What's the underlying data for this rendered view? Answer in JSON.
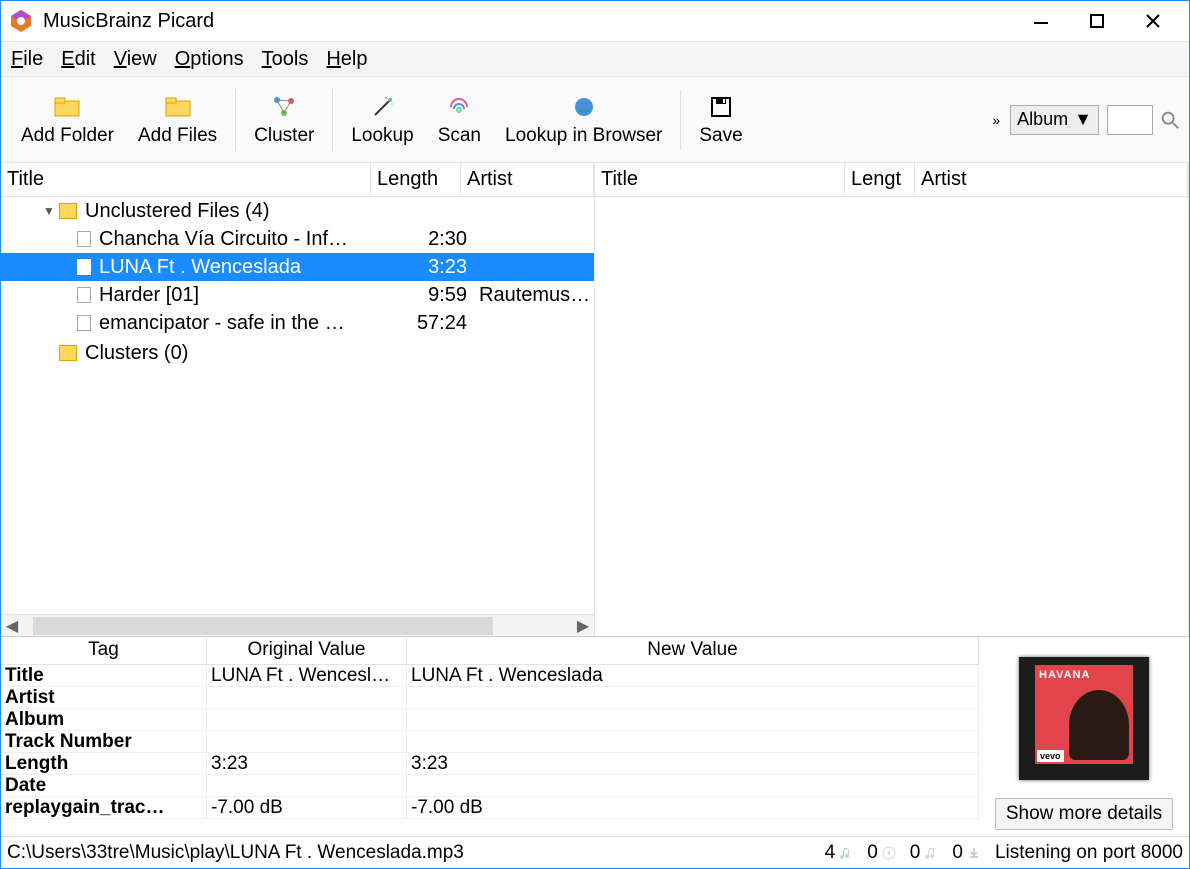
{
  "window": {
    "title": "MusicBrainz Picard"
  },
  "menu": {
    "items": [
      {
        "u": "F",
        "rest": "ile"
      },
      {
        "u": "E",
        "rest": "dit"
      },
      {
        "u": "V",
        "rest": "iew"
      },
      {
        "u": "O",
        "rest": "ptions"
      },
      {
        "u": "T",
        "rest": "ools"
      },
      {
        "u": "H",
        "rest": "elp"
      }
    ]
  },
  "toolbar": {
    "add_folder": "Add Folder",
    "add_files": "Add Files",
    "cluster": "Cluster",
    "lookup": "Lookup",
    "scan": "Scan",
    "lookup_browser": "Lookup in Browser",
    "save": "Save",
    "overflow": "»",
    "search_type": "Album"
  },
  "left_pane": {
    "headers": {
      "title": "Title",
      "length": "Length",
      "artist": "Artist"
    },
    "root_unclustered": "Unclustered Files (4)",
    "root_clusters": "Clusters (0)",
    "files": [
      {
        "title": "Chancha Vía Circuito - Inf…",
        "length": "2:30",
        "artist": "",
        "selected": false
      },
      {
        "title": "LUNA Ft . Wenceslada",
        "length": "3:23",
        "artist": "",
        "selected": true
      },
      {
        "title": "Harder [01]",
        "length": "9:59",
        "artist": "Rautemusik F",
        "selected": false
      },
      {
        "title": "emancipator - safe in the …",
        "length": "57:24",
        "artist": "",
        "selected": false
      }
    ]
  },
  "right_pane": {
    "headers": {
      "title": "Title",
      "length": "Lengt",
      "artist": "Artist"
    }
  },
  "tags": {
    "headers": {
      "tag": "Tag",
      "orig": "Original Value",
      "newv": "New Value"
    },
    "rows": [
      {
        "name": "Title",
        "orig": "LUNA Ft . Wencesl…",
        "newv": "LUNA Ft . Wenceslada"
      },
      {
        "name": "Artist",
        "orig": "",
        "newv": ""
      },
      {
        "name": "Album",
        "orig": "",
        "newv": ""
      },
      {
        "name": "Track Number",
        "orig": "",
        "newv": ""
      },
      {
        "name": "Length",
        "orig": "3:23",
        "newv": "3:23"
      },
      {
        "name": "Date",
        "orig": "",
        "newv": ""
      },
      {
        "name": "replaygain_trac…",
        "orig": "-7.00 dB",
        "newv": "-7.00 dB"
      }
    ]
  },
  "cover": {
    "album_text": "HAVANA",
    "vevo": "vevo",
    "show_details": "Show more details"
  },
  "status": {
    "path": "C:\\Users\\33tre\\Music\\play\\LUNA Ft . Wenceslada.mp3",
    "count1": "4",
    "count2": "0",
    "count3": "0",
    "count4": "0",
    "listening": "Listening on port 8000"
  }
}
